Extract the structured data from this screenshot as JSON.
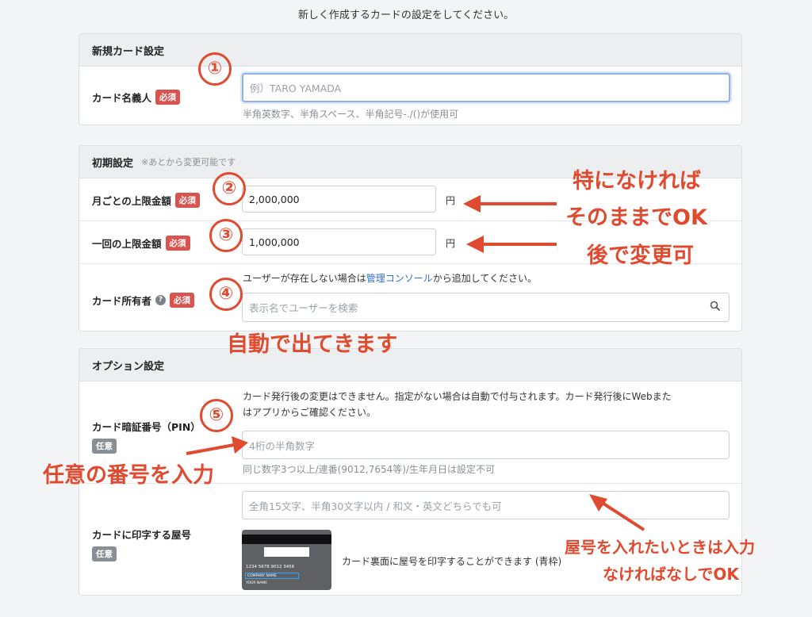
{
  "intro": "新しく作成するカードの設定をしてください。",
  "new_card": {
    "header": "新規カード設定",
    "cardholder": {
      "label": "カード名義人",
      "required": "必須",
      "placeholder": "例）TARO YAMADA",
      "help": "半角英数字、半角スペース、半角記号-./()が使用可"
    }
  },
  "initial": {
    "header": "初期設定",
    "note": "※あとから変更可能です",
    "monthly": {
      "label": "月ごとの上限金額",
      "required": "必須",
      "value": "2,000,000",
      "unit": "円"
    },
    "per_use": {
      "label": "一回の上限金額",
      "required": "必須",
      "value": "1,000,000",
      "unit": "円"
    },
    "owner": {
      "label": "カード所有者",
      "required": "必須",
      "desc_before": "ユーザーが存在しない場合は",
      "desc_link": "管理コンソール",
      "desc_after": "から追加してください。",
      "placeholder": "表示名でユーザーを検索"
    }
  },
  "options": {
    "header": "オプション設定",
    "pin": {
      "label": "カード暗証番号（PIN）",
      "optional": "任意",
      "desc_line1": "カード発行後の変更はできません。指定がない場合は自動で付与されます。カード発行後にWebまた",
      "desc_line2": "はアプリからご確認ください。",
      "placeholder": "4桁の半角数字",
      "help": "同じ数字3つ以上/連番(9012,7654等)/生年月日は設定不可"
    },
    "shop_name": {
      "label": "カードに印字する屋号",
      "optional": "任意",
      "placeholder": "全角15文字、半角30文字以内 / 和文・英文どちらでも可",
      "card_number": "1234 5678 9012 3456",
      "card_company": "COMPANY NAME",
      "card_name": "YOUR NAME",
      "card_desc": "カード裏面に屋号を印字することができます (青枠)"
    }
  },
  "annotations": {
    "n1": "①",
    "n2": "②",
    "n3": "③",
    "n4": "④",
    "n5": "⑤",
    "right1": "特になければ",
    "right2": "そのままでOK",
    "right3": "後で変更可",
    "owner_note": "自動で出てきます",
    "pin_note": "任意の番号を入力",
    "shop1": "屋号を入れたいときは入力",
    "shop2": "なければなしでOK"
  },
  "colors": {
    "annotation": "#e04a2f",
    "required": "#d9534f",
    "link": "#2f6fce"
  }
}
